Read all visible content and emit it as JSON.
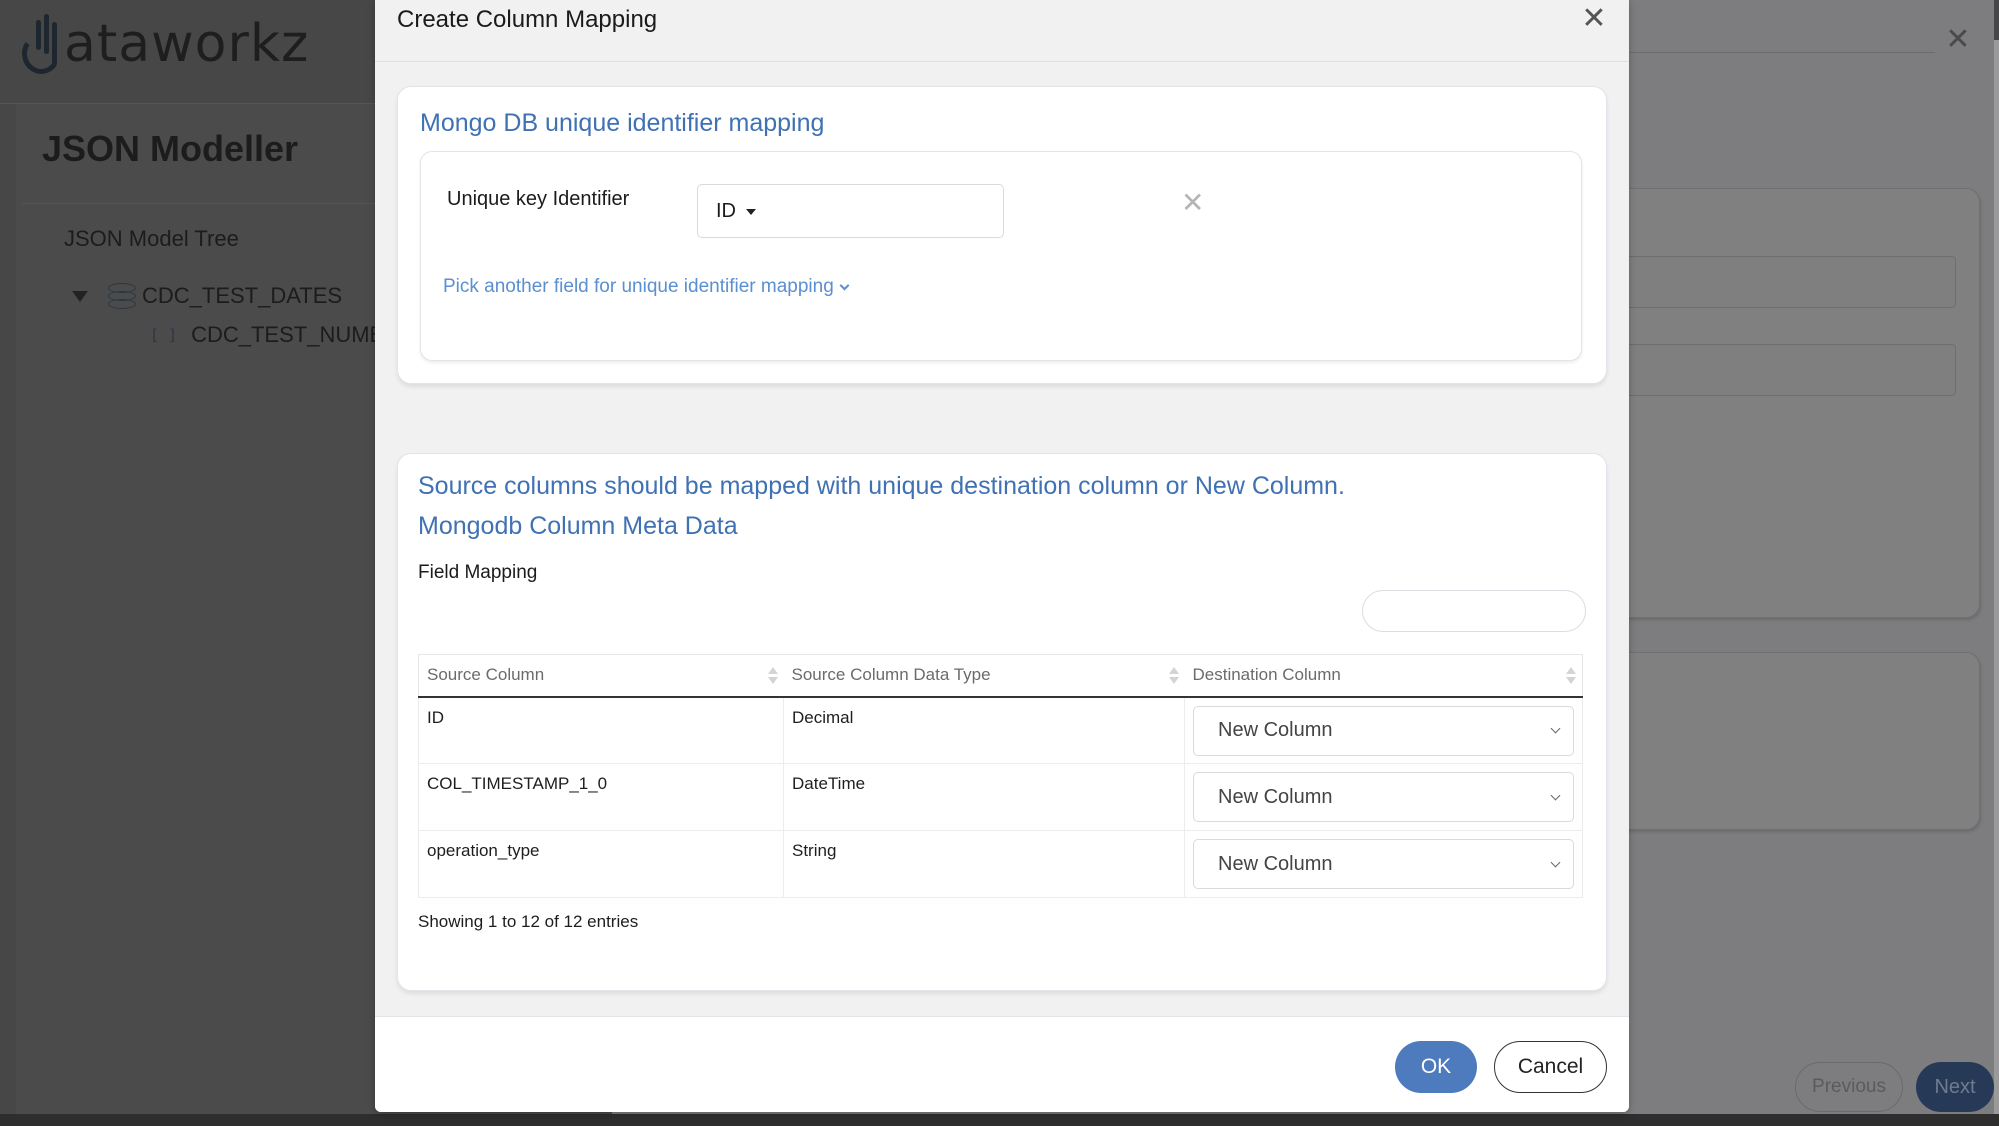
{
  "base_page": {
    "logo_text": "ataworkz",
    "page_title": "JSON Modeller",
    "tree_title": "JSON Model Tree",
    "tree_nodes": [
      {
        "label": "CDC_TEST_DATES",
        "icon": "database-icon",
        "expanded": true
      },
      {
        "label": "CDC_TEST_NUMBE",
        "icon": "array-brackets-icon"
      }
    ]
  },
  "mid_panel": {
    "close_icon": "close-icon",
    "previous_label": "Previous",
    "next_label": "Next"
  },
  "modal": {
    "title": "Create Column Mapping",
    "close_icon": "close-icon",
    "unique_section": {
      "heading": "Mongo DB unique identifier mapping",
      "key_label": "Unique key Identifier",
      "key_value": "ID",
      "remove_icon": "close-icon",
      "pick_another_label": "Pick another field for unique identifier mapping"
    },
    "mapping_section": {
      "notice": "Source columns should be mapped with unique destination column or New Column.",
      "meta_heading": "Mongodb Column Meta Data",
      "field_mapping_label": "Field Mapping",
      "search_value": "",
      "columns": [
        "Source Column",
        "Source Column Data Type",
        "Destination Column"
      ],
      "rows": [
        {
          "source": "ID",
          "type": "Decimal",
          "destination": "New Column"
        },
        {
          "source": "COL_TIMESTAMP_1_0",
          "type": "DateTime",
          "destination": "New Column"
        },
        {
          "source": "operation_type",
          "type": "String",
          "destination": "New Column"
        }
      ],
      "entries_info": "Showing 1 to 12 of 12 entries"
    },
    "ok_label": "OK",
    "cancel_label": "Cancel"
  },
  "colors": {
    "accent_blue": "#3f71b3",
    "link_blue": "#5a8fd0",
    "ok_button": "#4e7bbd",
    "next_button_dimmed": "#263a57"
  }
}
